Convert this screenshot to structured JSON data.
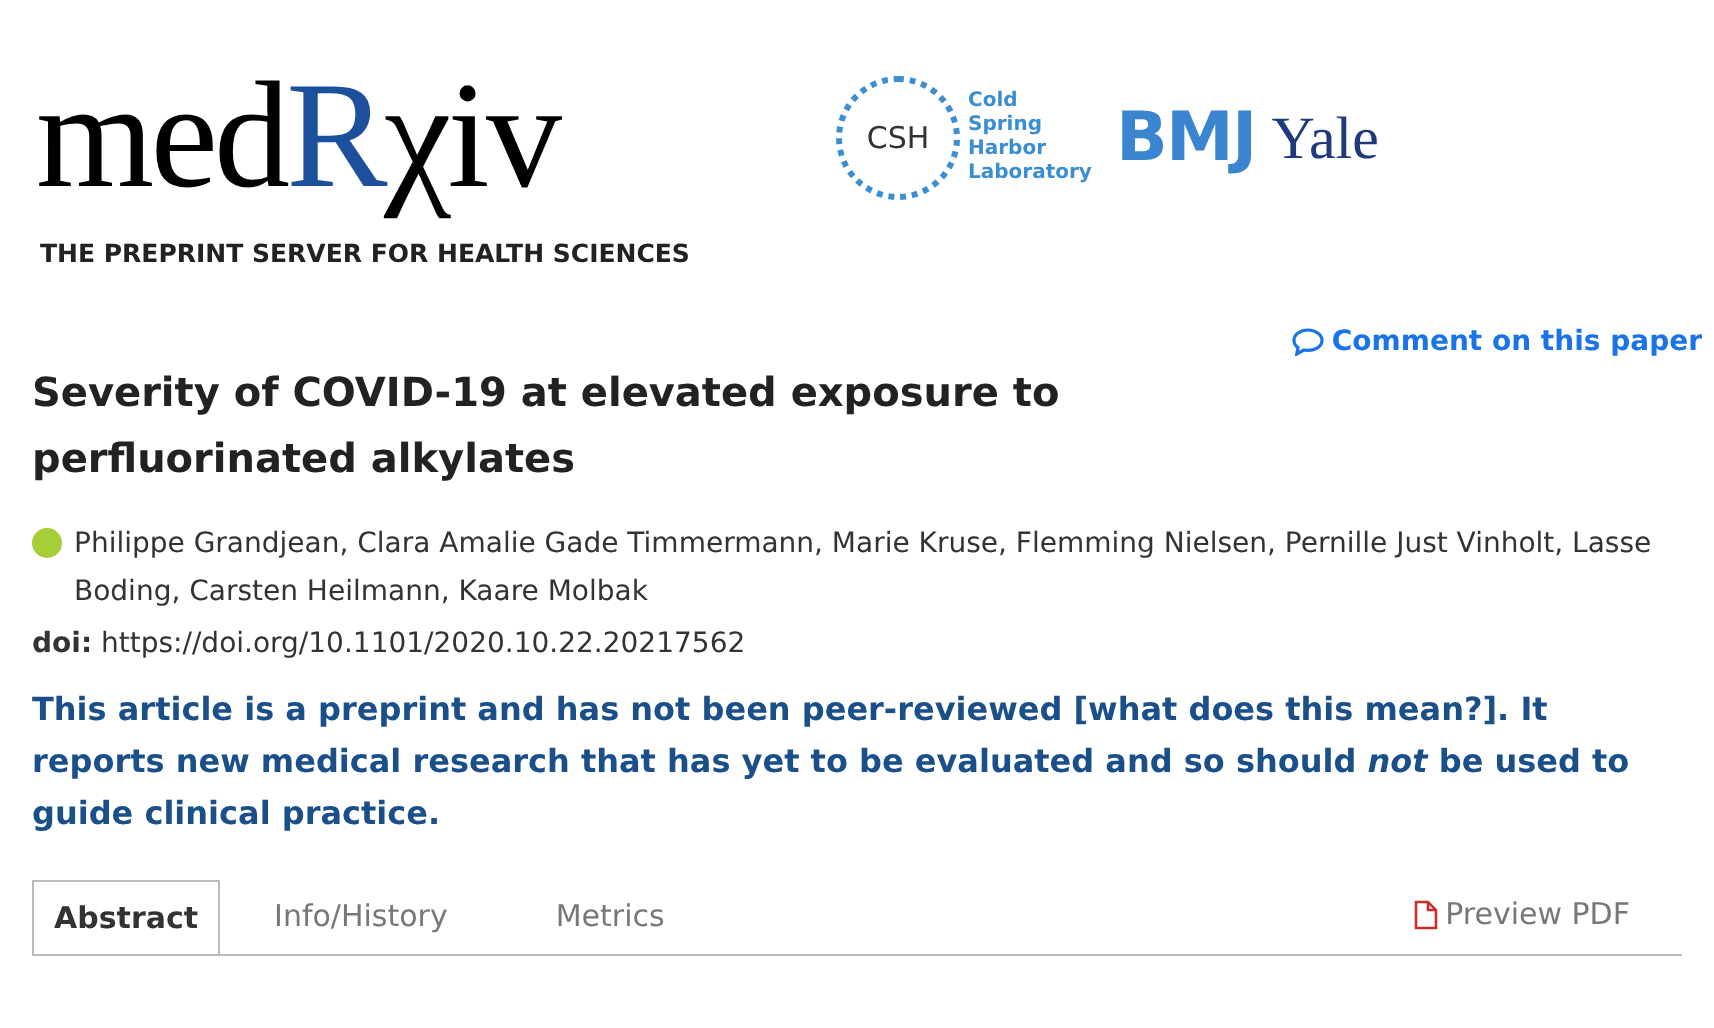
{
  "header": {
    "logo": {
      "part_1": "med",
      "part_2": "R",
      "part_3": "χiv"
    },
    "tagline": "THE PREPRINT SERVER FOR HEALTH SCIENCES",
    "partners": [
      {
        "kind": "csh",
        "badge": "CSH",
        "lines": [
          "Cold",
          "Spring",
          "Harbor",
          "Laboratory"
        ]
      },
      {
        "kind": "bmj",
        "name": "BMJ"
      },
      {
        "kind": "yale",
        "name": "Yale"
      }
    ]
  },
  "comment_link": "Comment on this paper",
  "title": "Severity of COVID-19 at elevated exposure to perfluorinated alkylates",
  "authors": "Philippe Grandjean, Clara Amalie Gade Timmermann, Marie Kruse, Flemming Nielsen, Pernille Just Vinholt, Lasse Boding, Carsten Heilmann, Kaare Molbak",
  "doi": {
    "label": "doi:",
    "value": "https://doi.org/10.1101/2020.10.22.20217562"
  },
  "notice": "This article is a preprint and has not been peer-reviewed [what does this mean?]. It reports new medical research that has yet to be evaluated and so should *not* be used to guide clinical practice.",
  "tabs": [
    {
      "label": "Abstract",
      "selected": true
    },
    {
      "label": "Info/History",
      "selected": false
    },
    {
      "label": "Metrics",
      "selected": false
    }
  ],
  "preview_pdf": "Preview PDF"
}
